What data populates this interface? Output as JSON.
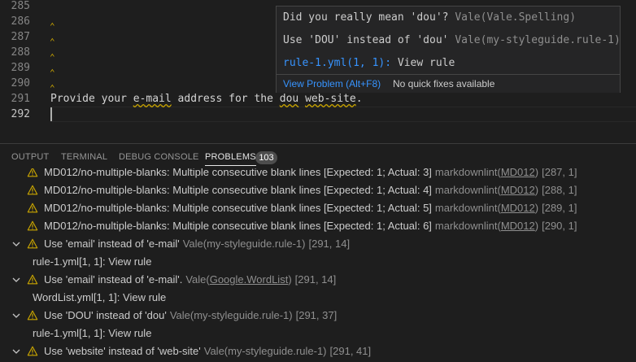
{
  "editor": {
    "lines": [
      {
        "num": "285",
        "text": "",
        "marker": false
      },
      {
        "num": "286",
        "text": "",
        "marker": true
      },
      {
        "num": "287",
        "text": "",
        "marker": true
      },
      {
        "num": "288",
        "text": "",
        "marker": true
      },
      {
        "num": "289",
        "text": "",
        "marker": true
      },
      {
        "num": "290",
        "text": "",
        "marker": true
      },
      {
        "num": "291",
        "text": "Provide your e-mail address for the dou web-site.",
        "marker": false
      },
      {
        "num": "292",
        "text": "",
        "marker": false
      }
    ],
    "line291": {
      "t1": "Provide your ",
      "w1": "e-mail",
      "t2": " address for the ",
      "w2": "dou",
      "t3": " ",
      "w3": "web-site",
      "t4": "."
    },
    "marker_glyph": "⌃"
  },
  "hover": {
    "row1_text": "Did you really mean 'dou'?",
    "row1_source": "Vale(Vale.Spelling)",
    "row2_text": "Use 'DOU' instead of 'dou'",
    "row2_source": "Vale(my-styleguide.rule-1)",
    "row3_link": "rule-1.yml(1, 1):",
    "row3_text": "View rule",
    "view_problem": "View Problem (Alt+F8)",
    "no_fixes": "No quick fixes available"
  },
  "panel": {
    "tabs": [
      "OUTPUT",
      "TERMINAL",
      "DEBUG CONSOLE",
      "PROBLEMS"
    ],
    "problems_count": "103",
    "rows": [
      {
        "kind": "problem",
        "chevron": false,
        "msg": "MD012/no-multiple-blanks: Multiple consecutive blank lines [Expected: 1; Actual: 3]",
        "src_pre": "markdownlint(",
        "src_code": "MD012",
        "src_post": ")",
        "loc": "[287, 1]"
      },
      {
        "kind": "problem",
        "chevron": false,
        "msg": "MD012/no-multiple-blanks: Multiple consecutive blank lines [Expected: 1; Actual: 4]",
        "src_pre": "markdownlint(",
        "src_code": "MD012",
        "src_post": ")",
        "loc": "[288, 1]"
      },
      {
        "kind": "problem",
        "chevron": false,
        "msg": "MD012/no-multiple-blanks: Multiple consecutive blank lines [Expected: 1; Actual: 5]",
        "src_pre": "markdownlint(",
        "src_code": "MD012",
        "src_post": ")",
        "loc": "[289, 1]"
      },
      {
        "kind": "problem",
        "chevron": false,
        "msg": "MD012/no-multiple-blanks: Multiple consecutive blank lines [Expected: 1; Actual: 6]",
        "src_pre": "markdownlint(",
        "src_code": "MD012",
        "src_post": ")",
        "loc": "[290, 1]"
      },
      {
        "kind": "problem",
        "chevron": true,
        "msg": "Use 'email' instead of 'e-mail'",
        "src_pre": "Vale(my-styleguide.rule-1)",
        "src_code": "",
        "src_post": "",
        "loc": "[291, 14]"
      },
      {
        "kind": "sub",
        "text": "rule-1.yml[1, 1]: View rule"
      },
      {
        "kind": "problem",
        "chevron": true,
        "msg": "Use 'email' instead of 'e-mail'.",
        "src_pre": "Vale(",
        "src_code": "Google.WordList",
        "src_post": ")",
        "loc": "[291, 14]"
      },
      {
        "kind": "sub",
        "text": "WordList.yml[1, 1]: View rule"
      },
      {
        "kind": "problem",
        "chevron": true,
        "msg": "Use 'DOU' instead of 'dou'",
        "src_pre": "Vale(my-styleguide.rule-1)",
        "src_code": "",
        "src_post": "",
        "loc": "[291, 37]"
      },
      {
        "kind": "sub",
        "text": "rule-1.yml[1, 1]: View rule"
      },
      {
        "kind": "problem",
        "chevron": true,
        "msg": "Use 'website' instead of 'web-site'",
        "src_pre": "Vale(my-styleguide.rule-1)",
        "src_code": "",
        "src_post": "",
        "loc": "[291, 41]"
      }
    ]
  },
  "icons": {
    "warning": "warning-icon",
    "chevron": "chevron-down-icon"
  },
  "colors": {
    "warning": "#cca700",
    "link": "#3794ff",
    "background": "#1e1e1e",
    "hover_bg": "#252526"
  }
}
